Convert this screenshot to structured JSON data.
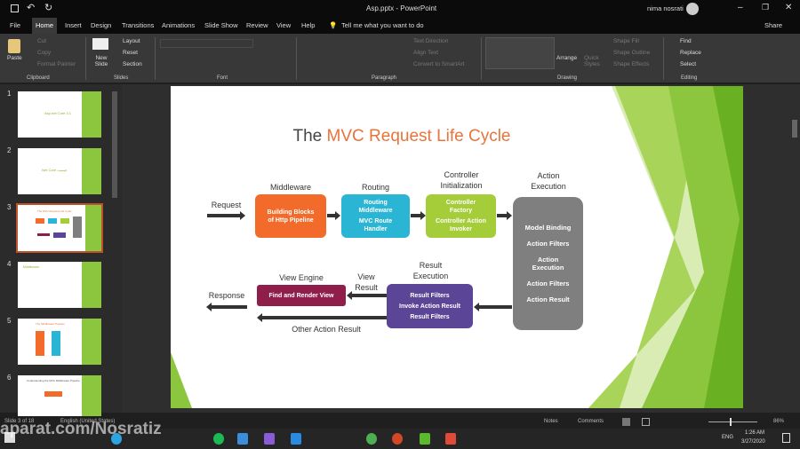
{
  "window": {
    "title": "Asp.pptx  -  PowerPoint",
    "user": "nima nosrati"
  },
  "tabs": [
    "File",
    "Home",
    "Insert",
    "Design",
    "Transitions",
    "Animations",
    "Slide Show",
    "Review",
    "View",
    "Help"
  ],
  "tell_me": "Tell me what you want to do",
  "share": "Share",
  "ribbon": {
    "clipboard": {
      "paste": "Paste",
      "cut": "Cut",
      "copy": "Copy",
      "format_painter": "Format Painter",
      "label": "Clipboard"
    },
    "slides": {
      "new_slide": "New Slide",
      "layout": "Layout",
      "reset": "Reset",
      "section": "Section",
      "label": "Slides"
    },
    "font": {
      "label": "Font"
    },
    "paragraph": {
      "text_direction": "Text Direction",
      "align_text": "Align Text",
      "smartart": "Convert to SmartArt",
      "label": "Paragraph"
    },
    "drawing": {
      "arrange": "Arrange",
      "quick_styles": "Quick Styles",
      "shape_fill": "Shape Fill",
      "shape_outline": "Shape Outline",
      "shape_effects": "Shape Effects",
      "label": "Drawing"
    },
    "editing": {
      "find": "Find",
      "replace": "Replace",
      "select": "Select",
      "label": "Editing"
    }
  },
  "thumbnails": [
    {
      "num": "1",
      "text": "Asp.net Core 3.1"
    },
    {
      "num": "2",
      "text": ".Net Core چیست"
    },
    {
      "num": "3",
      "text": "The MVC Request Life Cycle"
    },
    {
      "num": "4",
      "text": "Middleware"
    },
    {
      "num": "5",
      "text": "The Middleware Pipeline"
    },
    {
      "num": "6",
      "text": "Understanding the MVC Middleware Pipeline"
    }
  ],
  "slide": {
    "title_plain": "The ",
    "title_accent": "MVC Request Life Cycle",
    "accent_color": "#e8743b",
    "request": "Request",
    "response": "Response",
    "middleware": {
      "header": "Middleware",
      "body": "Building Blocks of Http Pipeline",
      "color": "#f26b2a"
    },
    "routing": {
      "header": "Routing",
      "line1": "Routing Middleware",
      "line2": "MVC Route Handler",
      "color": "#2bb5d4"
    },
    "controller": {
      "header1": "Controller",
      "header2": "Initialization",
      "line1": "Controller Factory",
      "line2": "Controller Action Invoker",
      "color": "#a5cd3a"
    },
    "action": {
      "header1": "Action",
      "header2": "Execution",
      "items": [
        "Model Binding",
        "Action Filters",
        "Action Execution",
        "Action Filters",
        "Action Result"
      ],
      "color": "#7f7f7f"
    },
    "result": {
      "header1": "Result",
      "header2": "Execution",
      "items": [
        "Result Filters",
        "Invoke Action Result",
        "Result Filters"
      ],
      "color": "#5b4597"
    },
    "view_result": {
      "line1": "View",
      "line2": "Result"
    },
    "view_engine": {
      "header": "View Engine",
      "body": "Find and Render View",
      "color": "#8f1f4a"
    },
    "other": "Other Action Result"
  },
  "status": {
    "slide": "Slide 3 of 18",
    "language": "English (United States)",
    "notes": "Notes",
    "comments": "Comments",
    "zoom": "86%"
  },
  "taskbar": {
    "lang": "ENG",
    "time": "1:26 AM",
    "date": "3/27/2020",
    "watermark": "aparat.com/Nosratiz"
  }
}
